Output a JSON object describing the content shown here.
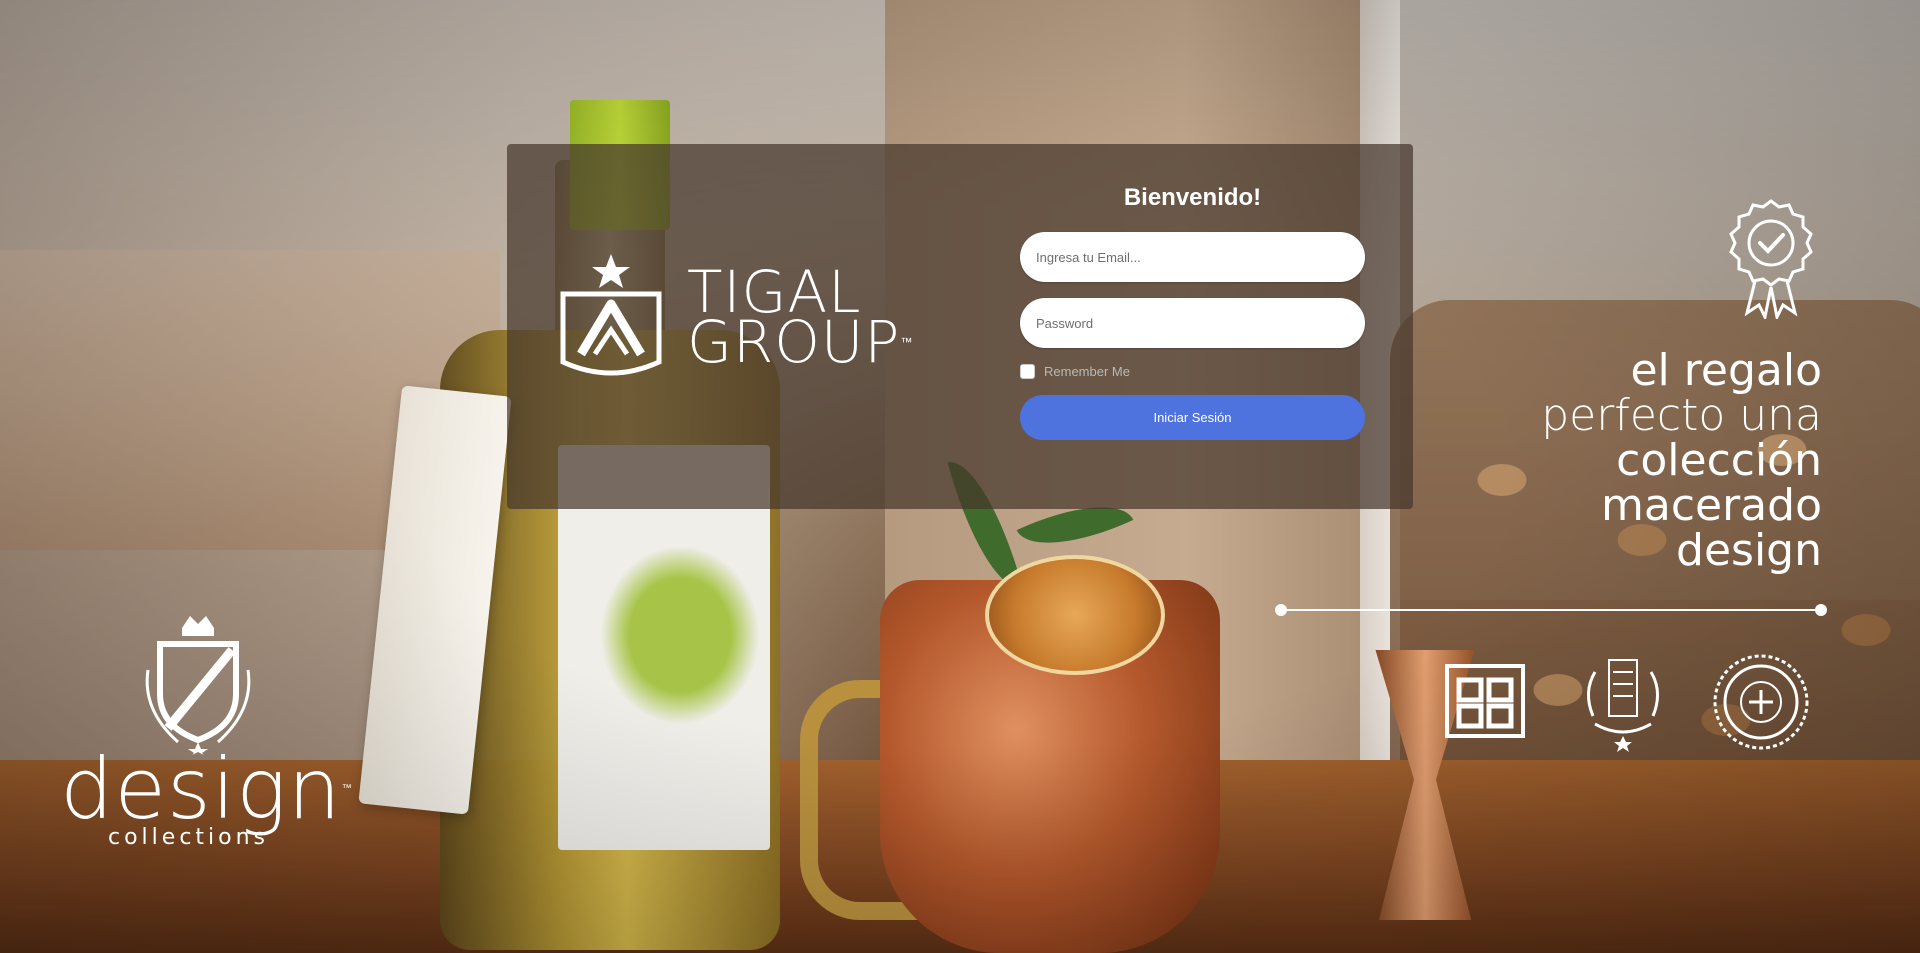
{
  "brand": {
    "name_line1": "TIGAL",
    "name_line2": "GROUP",
    "trademark": "™"
  },
  "login": {
    "title": "Bienvenido!",
    "email_placeholder": "Ingresa tu Email...",
    "password_placeholder": "Password",
    "remember_label": "Remember Me",
    "submit_label": "Iniciar Sesión"
  },
  "promo": {
    "tagline": [
      "el regalo",
      "perfecto una",
      "colección",
      "macerado",
      "design"
    ],
    "badges": [
      {
        "icon": "hecho-en-peru-badge"
      },
      {
        "icon": "macerado-design-badge"
      },
      {
        "icon": "100-seal-badge"
      }
    ],
    "award_icon": "award-ribbon-icon"
  },
  "design_logo": {
    "word": "design",
    "trademark": "™",
    "sub": "collections"
  },
  "colors": {
    "panel_bg": "#46372d",
    "primary_button": "#4e73df",
    "text_white": "#ffffff",
    "remember_text": "#b9b9b9"
  }
}
